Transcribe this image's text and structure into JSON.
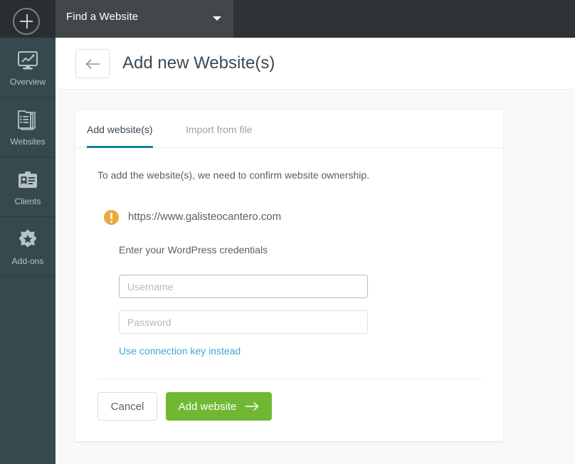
{
  "topbar": {
    "add_button_icon": "plus-icon",
    "site_picker_label": "Find a Website",
    "site_picker_caret_icon": "chevron-down-icon"
  },
  "sidebar": {
    "items": [
      {
        "label": "Overview",
        "icon": "monitor-chart-icon"
      },
      {
        "label": "Websites",
        "icon": "stacked-pages-icon"
      },
      {
        "label": "Clients",
        "icon": "id-card-icon"
      },
      {
        "label": "Add-ons",
        "icon": "puzzle-star-icon"
      }
    ]
  },
  "header": {
    "back_icon": "arrow-left-icon",
    "title": "Add new Website(s)"
  },
  "card": {
    "tabs": [
      {
        "label": "Add website(s)",
        "active": true
      },
      {
        "label": "Import from file",
        "active": false
      }
    ],
    "intro_text": "To add the website(s), we need to confirm website ownership.",
    "site": {
      "status_icon": "warning-exclamation-icon",
      "url": "https://www.galisteocantero.com"
    },
    "credentials": {
      "label": "Enter your WordPress credentials",
      "username_value": "",
      "username_placeholder": "Username",
      "password_value": "",
      "password_placeholder": "Password",
      "connection_key_link": "Use connection key instead"
    },
    "actions": {
      "cancel_label": "Cancel",
      "submit_label": "Add website",
      "submit_icon": "arrow-right-icon"
    }
  },
  "colors": {
    "accent_tab": "#0e82ab",
    "submit_green": "#70b832",
    "link_blue": "#3ca9d5",
    "warning_orange": "#eba93a",
    "sidebar_bg": "#35494e",
    "topbar_bg": "#2f3236"
  }
}
